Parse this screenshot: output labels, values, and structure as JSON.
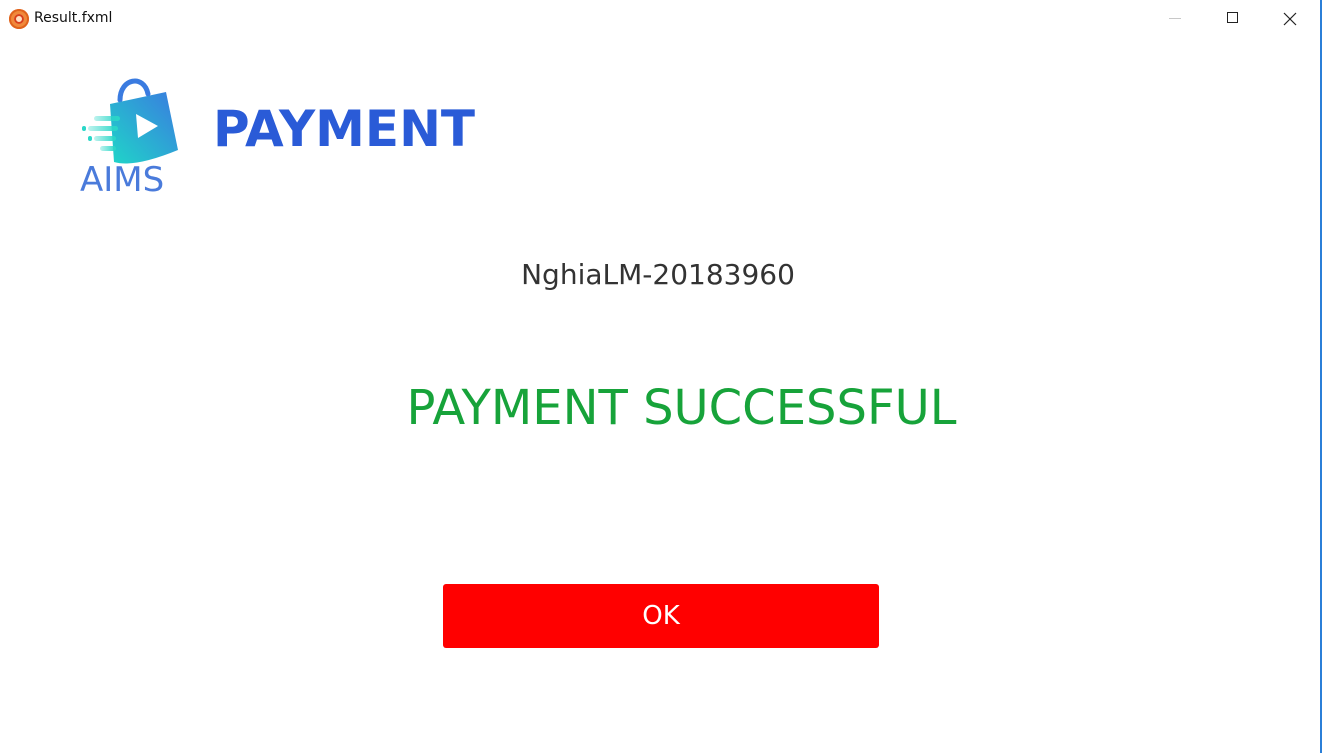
{
  "window": {
    "title": "Result.fxml",
    "icon": "app-icon",
    "controls": {
      "minimize": "minimize-icon",
      "maximize": "maximize-icon",
      "close": "close-icon"
    }
  },
  "header": {
    "logo_text": "AIMS",
    "title": "PAYMENT"
  },
  "content": {
    "user": "NghiaLM-20183960",
    "result": "PAYMENT SUCCESSFUL"
  },
  "actions": {
    "ok_label": "OK"
  },
  "colors": {
    "title": "#2a5bd7",
    "success": "#17a33a",
    "ok_button": "#ff0000",
    "logo": "#4a7bdb"
  }
}
